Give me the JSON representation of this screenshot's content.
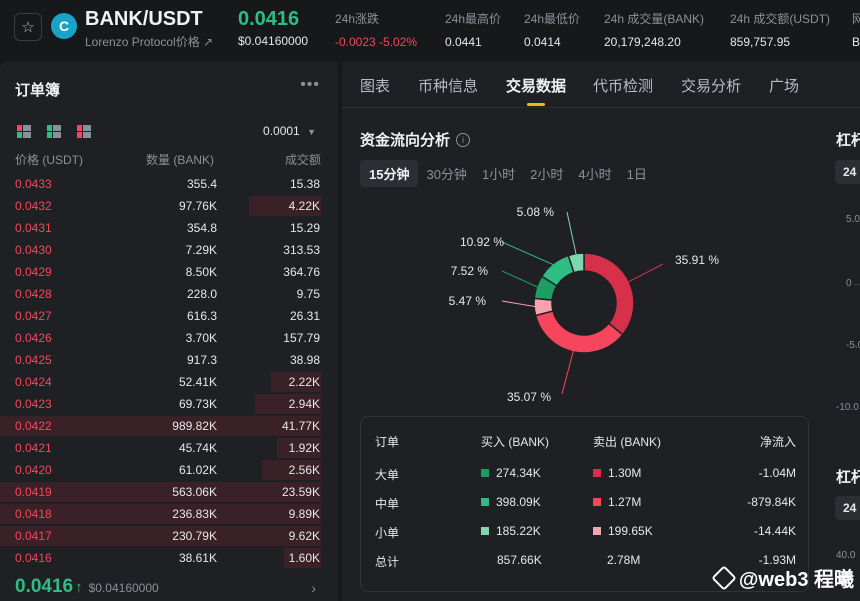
{
  "header": {
    "pair": "BANK/USDT",
    "pair_sub": "Lorenzo Protocol价格 ↗",
    "last_price": "0.0416",
    "last_price_usd": "$0.04160000",
    "stats": [
      {
        "label": "24h涨跌",
        "value": "-0.0023 -5.02%",
        "color": "red"
      },
      {
        "label": "24h最高价",
        "value": "0.0441",
        "color": ""
      },
      {
        "label": "24h最低价",
        "value": "0.0414",
        "color": ""
      },
      {
        "label": "24h 成交量(BANK)",
        "value": "20,179,248.20",
        "color": ""
      },
      {
        "label": "24h 成交额(USDT)",
        "value": "859,757.95",
        "color": ""
      },
      {
        "label": "网",
        "value": "B",
        "color": ""
      }
    ]
  },
  "orderbook": {
    "title": "订单簿",
    "precision": "0.0001",
    "columns": [
      "价格 (USDT)",
      "数量 (BANK)",
      "成交额"
    ],
    "rows": [
      {
        "price": "0.0433",
        "qty": "355.4",
        "total": "15.38",
        "depth": 0
      },
      {
        "price": "0.0432",
        "qty": "97.76K",
        "total": "4.22K",
        "depth": 0.33
      },
      {
        "price": "0.0431",
        "qty": "354.8",
        "total": "15.29",
        "depth": 0
      },
      {
        "price": "0.0430",
        "qty": "7.29K",
        "total": "313.53",
        "depth": 0
      },
      {
        "price": "0.0429",
        "qty": "8.50K",
        "total": "364.76",
        "depth": 0
      },
      {
        "price": "0.0428",
        "qty": "228.0",
        "total": "9.75",
        "depth": 0
      },
      {
        "price": "0.0427",
        "qty": "616.3",
        "total": "26.31",
        "depth": 0
      },
      {
        "price": "0.0426",
        "qty": "3.70K",
        "total": "157.79",
        "depth": 0
      },
      {
        "price": "0.0425",
        "qty": "917.3",
        "total": "38.98",
        "depth": 0
      },
      {
        "price": "0.0424",
        "qty": "52.41K",
        "total": "2.22K",
        "depth": 0.23
      },
      {
        "price": "0.0423",
        "qty": "69.73K",
        "total": "2.94K",
        "depth": 0.3
      },
      {
        "price": "0.0422",
        "qty": "989.82K",
        "total": "41.77K",
        "depth": 1.0
      },
      {
        "price": "0.0421",
        "qty": "45.74K",
        "total": "1.92K",
        "depth": 0.2
      },
      {
        "price": "0.0420",
        "qty": "61.02K",
        "total": "2.56K",
        "depth": 0.27
      },
      {
        "price": "0.0419",
        "qty": "563.06K",
        "total": "23.59K",
        "depth": 1.0
      },
      {
        "price": "0.0418",
        "qty": "236.83K",
        "total": "9.89K",
        "depth": 1.0
      },
      {
        "price": "0.0417",
        "qty": "230.79K",
        "total": "9.62K",
        "depth": 1.0
      },
      {
        "price": "0.0416",
        "qty": "38.61K",
        "total": "1.60K",
        "depth": 0.17
      }
    ],
    "footer_price": "0.0416",
    "footer_arrow": "↑",
    "footer_usd": "$0.04160000"
  },
  "tabs": [
    "图表",
    "币种信息",
    "交易数据",
    "代币检测",
    "交易分析",
    "广场"
  ],
  "active_tab": 2,
  "fund_flow": {
    "title": "资金流向分析",
    "periods": [
      "15分钟",
      "30分钟",
      "1小时",
      "2小时",
      "4小时",
      "1日"
    ],
    "active_period": 0,
    "table": {
      "headers": [
        "订单",
        "买入 (BANK)",
        "卖出 (BANK)",
        "净流入"
      ],
      "rows": [
        {
          "label": "大单",
          "buy": "274.34K",
          "sell": "1.30M",
          "net": "-1.04M",
          "buy_color": "#1f9e63",
          "sell_color": "#d9304a"
        },
        {
          "label": "中单",
          "buy": "398.09K",
          "sell": "1.27M",
          "net": "-879.84K",
          "buy_color": "#2ebd85",
          "sell_color": "#f6465d"
        },
        {
          "label": "小单",
          "buy": "185.22K",
          "sell": "199.65K",
          "net": "-14.44K",
          "buy_color": "#7fd6b0",
          "sell_color": "#f5a3ad"
        },
        {
          "label": "总计",
          "buy": "857.66K",
          "sell": "2.78M",
          "net": "-1.93M",
          "buy_color": "",
          "sell_color": ""
        }
      ]
    }
  },
  "chart_data": {
    "type": "pie",
    "title": "",
    "slices": [
      {
        "label": "35.91 %",
        "value": 35.91,
        "color": "#d6304a"
      },
      {
        "label": "35.07 %",
        "value": 35.07,
        "color": "#f6465d"
      },
      {
        "label": "5.47 %",
        "value": 5.47,
        "color": "#f5a3ad"
      },
      {
        "label": "7.52 %",
        "value": 7.52,
        "color": "#1f9e63"
      },
      {
        "label": "10.92 %",
        "value": 10.92,
        "color": "#2ebd85"
      },
      {
        "label": "5.08 %",
        "value": 5.08,
        "color": "#7fd6b0"
      }
    ]
  },
  "side_panel": {
    "title_1": "杠杆",
    "chip_1": "24",
    "axis_1": [
      "5.0",
      "0",
      "-5.0",
      "-10.0"
    ],
    "title_2": "杠杆",
    "chip_2": "24",
    "axis_2": [
      "40.0"
    ]
  },
  "watermark": "@web3  程曦",
  "colors": {
    "up": "#2ebd85",
    "down": "#f6465d",
    "accent": "#f0b90b"
  }
}
